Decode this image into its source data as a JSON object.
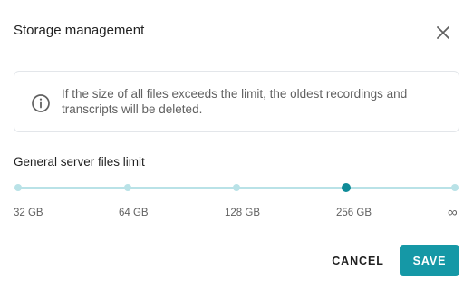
{
  "dialog": {
    "title": "Storage management",
    "close_icon": "close-icon"
  },
  "info": {
    "icon": "info-icon",
    "text": "If the size of all files exceeds the limit, the oldest recordings and transcripts will be deleted."
  },
  "limit_slider": {
    "label": "General server files limit",
    "ticks": [
      "32 GB",
      "64 GB",
      "128 GB",
      "256 GB",
      "∞"
    ],
    "selected_index": 3,
    "selected_value": "256 GB"
  },
  "actions": {
    "cancel_label": "CANCEL",
    "save_label": "SAVE"
  },
  "colors": {
    "accent": "#1598a6",
    "thumb": "#0f8b98",
    "track": "#b9e2e7",
    "border": "#e3e6ea",
    "text_primary": "#212121",
    "text_secondary": "#616161"
  }
}
